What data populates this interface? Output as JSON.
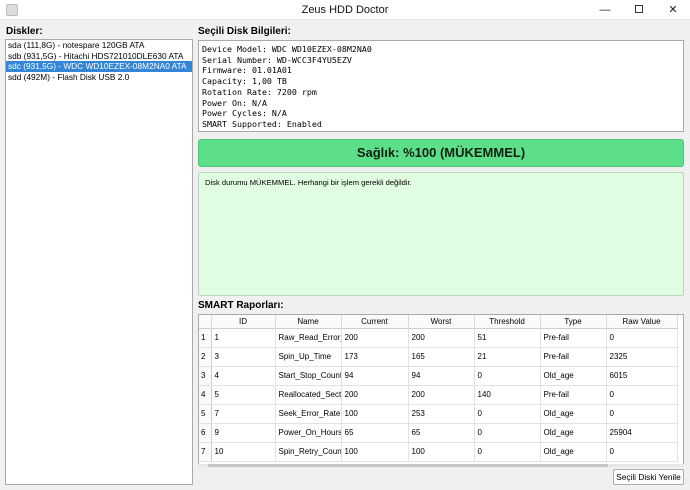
{
  "window": {
    "title": "Zeus HDD Doctor",
    "controls": {
      "minimize": "—",
      "maximize": "",
      "close": "✕"
    }
  },
  "disks": {
    "label": "Diskler:",
    "items": [
      "sda (111,8G) - notespare 120GB ATA",
      "sdb (931,5G) - Hitachi HDS721010DLE630 ATA",
      "sdc (931,5G) - WDC WD10EZEX-08M2NA0 ATA",
      "sdd (492M) - Flash Disk USB 2.0"
    ],
    "selected_index": 2
  },
  "info": {
    "label": "Seçili Disk Bilgileri:",
    "lines": [
      "Device Model: WDC WD10EZEX-08M2NA0",
      "Serial Number: WD-WCC3F4YU5EZV",
      "Firmware: 01.01A01",
      "Capacity: 1,00 TB",
      "Rotation Rate: 7200 rpm",
      "Power On: N/A",
      "Power Cycles: N/A",
      "SMART Supported: Enabled"
    ]
  },
  "health": {
    "text": "Sağlık: %100 (MÜKEMMEL)",
    "color": "#5ddf8a"
  },
  "status": {
    "text": "Disk durumu MÜKEMMEL. Herhangi bir işlem gerekli değildir.",
    "bg_color": "#e1fde1"
  },
  "smart": {
    "label": "SMART Raporları:",
    "columns": [
      "ID",
      "Name",
      "Current",
      "Worst",
      "Threshold",
      "Type",
      "Raw Value"
    ],
    "rows": [
      [
        "1",
        "1",
        "Raw_Read_Error_Rate",
        "200",
        "200",
        "51",
        "Pre-fail",
        "0"
      ],
      [
        "2",
        "3",
        "Spin_Up_Time",
        "173",
        "165",
        "21",
        "Pre-fail",
        "2325"
      ],
      [
        "3",
        "4",
        "Start_Stop_Count",
        "94",
        "94",
        "0",
        "Old_age",
        "6015"
      ],
      [
        "4",
        "5",
        "Reallocated_Sector_Ct",
        "200",
        "200",
        "140",
        "Pre-fail",
        "0"
      ],
      [
        "5",
        "7",
        "Seek_Error_Rate",
        "100",
        "253",
        "0",
        "Old_age",
        "0"
      ],
      [
        "6",
        "9",
        "Power_On_Hours",
        "65",
        "65",
        "0",
        "Old_age",
        "25904"
      ],
      [
        "7",
        "10",
        "Spin_Retry_Count",
        "100",
        "100",
        "0",
        "Old_age",
        "0"
      ]
    ]
  },
  "refresh_button": {
    "label": "Seçili Diski Yenile"
  },
  "selection_color": "#3385d6"
}
